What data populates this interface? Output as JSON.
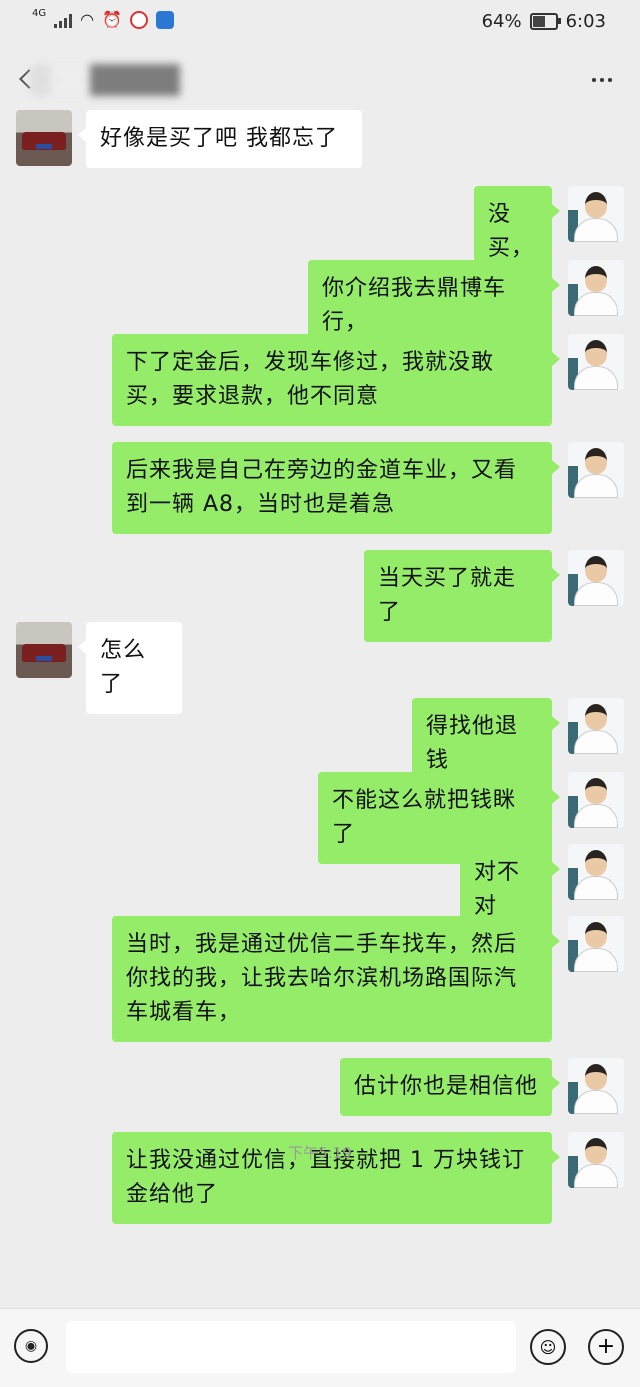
{
  "status_bar": {
    "network": "4G",
    "battery_percent_label": "64%",
    "battery_level": 0.64,
    "time": "6:03"
  },
  "nav": {
    "icons": [
      "back-icon",
      "more-icon"
    ]
  },
  "messages": [
    {
      "side": "left",
      "text": "好像是买了吧  我都忘了"
    },
    {
      "side": "right",
      "text": "没买，"
    },
    {
      "side": "right",
      "text": "你介绍我去鼎博车行，"
    },
    {
      "side": "right",
      "text": "下了定金后，发现车修过，我就没敢买，要求退款，他不同意"
    },
    {
      "side": "right",
      "text": "后来我是自己在旁边的金道车业，又看到一辆 A8，当时也是着急"
    },
    {
      "side": "right",
      "text": "当天买了就走了"
    },
    {
      "side": "left",
      "text": "怎么了"
    },
    {
      "side": "right",
      "text": "得找他退钱"
    },
    {
      "side": "right",
      "text": "不能这么就把钱眯了"
    },
    {
      "side": "right",
      "text": "对不对"
    },
    {
      "side": "right",
      "text": "当时，我是通过优信二手车找车，然后你找的我，让我去哈尔滨机场路国际汽车城看车，"
    },
    {
      "side": "right",
      "text": "估计你也是相信他"
    },
    {
      "side": "right",
      "text": "让我没通过优信，直接就把 1 万块钱订金给他了"
    }
  ],
  "timestamp": "下午5:19",
  "input_bar": {
    "icons": [
      "voice-icon",
      "emoji-icon",
      "plus-icon"
    ]
  },
  "colors": {
    "background": "#ededed",
    "bubble_sent": "#95ec69",
    "bubble_received": "#ffffff"
  }
}
